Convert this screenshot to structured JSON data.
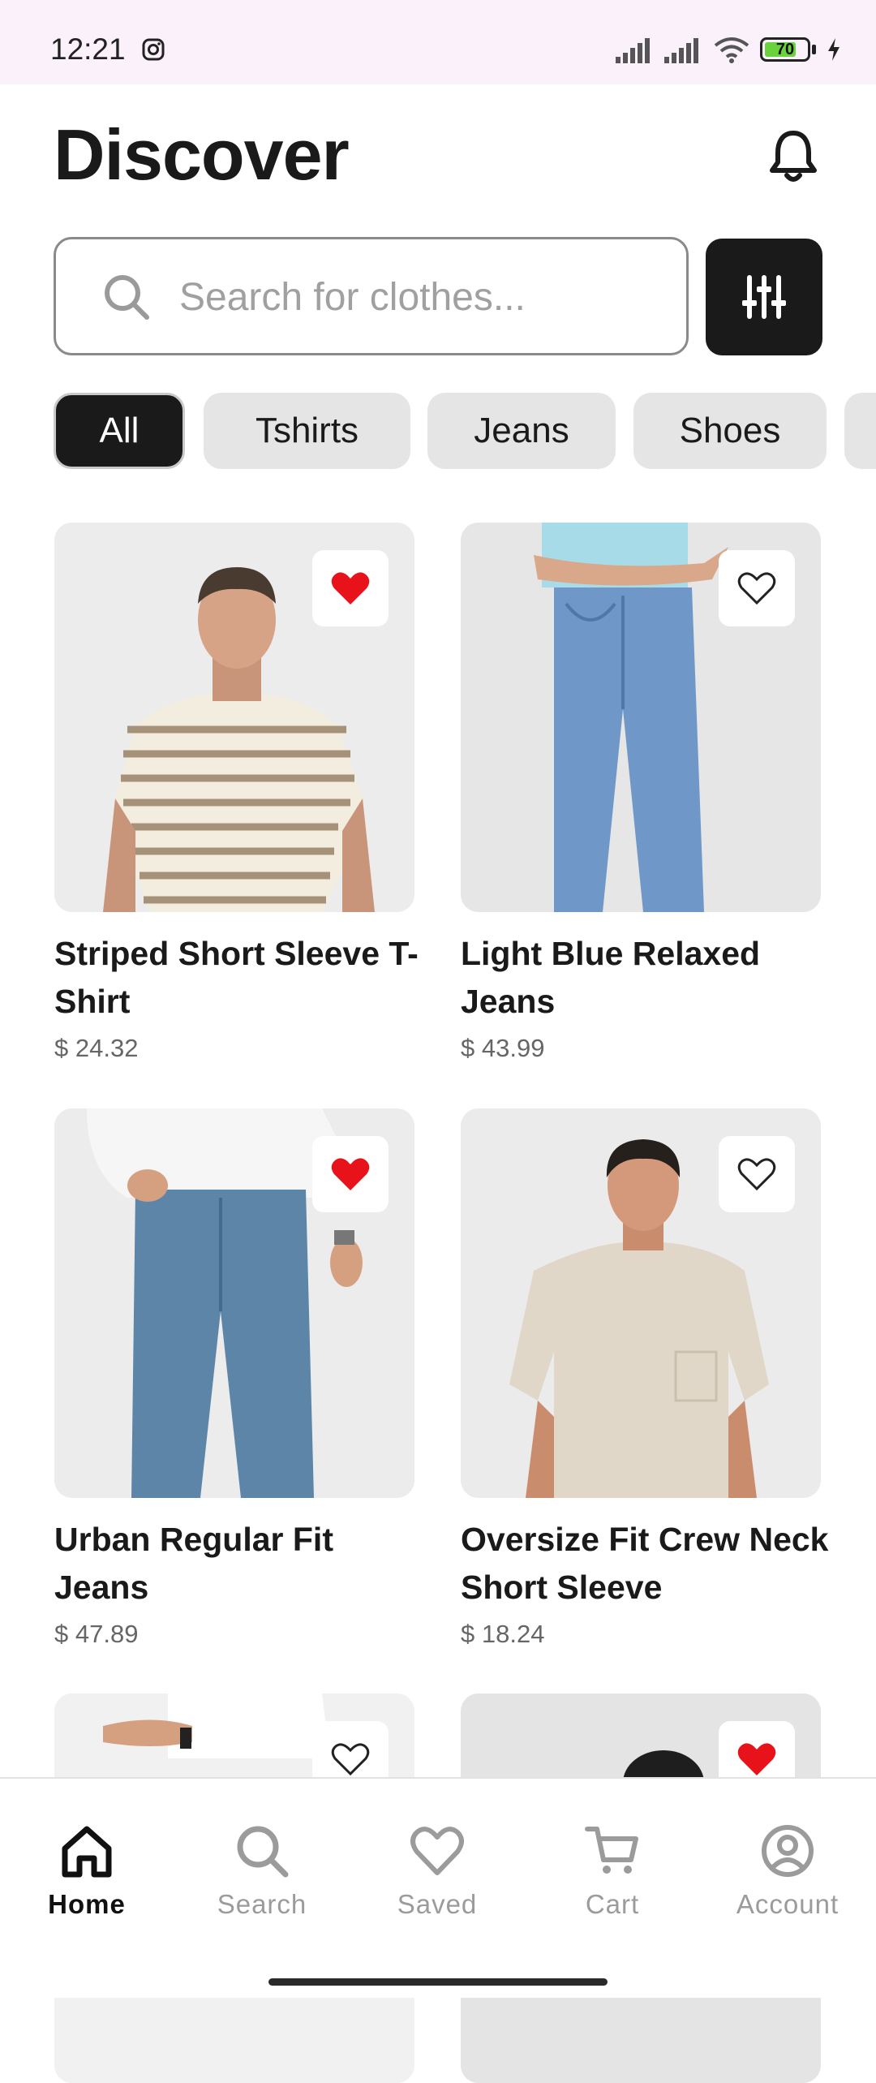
{
  "status": {
    "time": "12:21",
    "battery": "70"
  },
  "header": {
    "title": "Discover"
  },
  "search": {
    "placeholder": "Search for clothes..."
  },
  "chips": [
    "All",
    "Tshirts",
    "Jeans",
    "Shoes"
  ],
  "products": [
    {
      "name": "Striped Short Sleeve T-Shirt",
      "price": "$ 24.32",
      "favorited": true
    },
    {
      "name": "Light Blue Relaxed Jeans",
      "price": "$ 43.99",
      "favorited": false
    },
    {
      "name": "Urban Regular Fit Jeans",
      "price": "$ 47.89",
      "favorited": true
    },
    {
      "name": "Oversize Fit Crew Neck Short Sleeve",
      "price": "$ 18.24",
      "favorited": false
    },
    {
      "favorited": false
    },
    {
      "favorited": true
    }
  ],
  "nav": {
    "home": "Home",
    "search": "Search",
    "saved": "Saved",
    "cart": "Cart",
    "account": "Account"
  },
  "colors": {
    "accent": "#1a1a1a",
    "favorite": "#e8121a",
    "status_bar": "#fbf1fa"
  }
}
